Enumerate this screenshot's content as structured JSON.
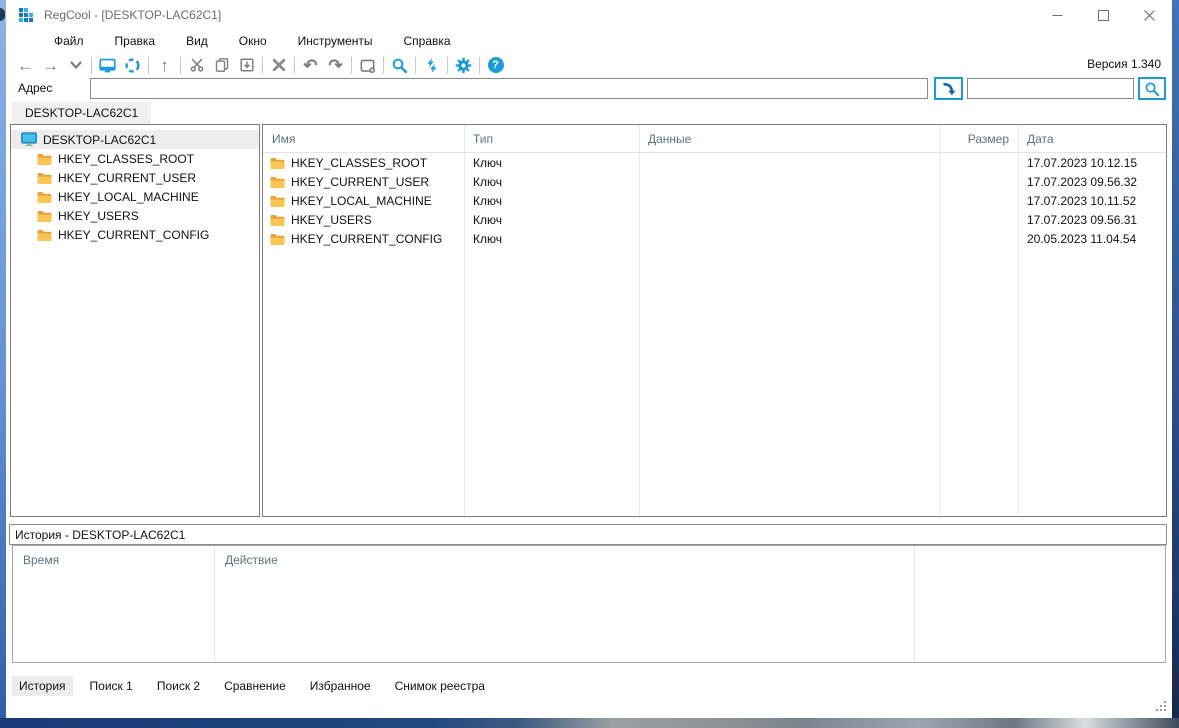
{
  "window": {
    "title": "RegCool - [DESKTOP-LAC62C1]",
    "version": "Версия 1.340"
  },
  "menu": [
    "Файл",
    "Правка",
    "Вид",
    "Окно",
    "Инструменты",
    "Справка"
  ],
  "toolbar": {
    "icons": [
      "back",
      "forward",
      "dropdown",
      "connect-computer",
      "refresh",
      "up",
      "cut",
      "copy",
      "import",
      "delete",
      "undo",
      "redo",
      "new-key",
      "search",
      "compare",
      "settings",
      "help"
    ],
    "glyphs": {
      "back": "←",
      "forward": "→",
      "up": "↑",
      "undo": "↶",
      "redo": "↷",
      "help": "?"
    }
  },
  "address": {
    "label": "Адрес",
    "value": "",
    "tab": "DESKTOP-LAC62C1"
  },
  "quick_search": {
    "value": ""
  },
  "tree": {
    "root": "DESKTOP-LAC62C1",
    "items": [
      "HKEY_CLASSES_ROOT",
      "HKEY_CURRENT_USER",
      "HKEY_LOCAL_MACHINE",
      "HKEY_USERS",
      "HKEY_CURRENT_CONFIG"
    ]
  },
  "list": {
    "columns": [
      "Имя",
      "Тип",
      "Данные",
      "Размер",
      "Дата"
    ],
    "rows": [
      {
        "name": "HKEY_CLASSES_ROOT",
        "type": "Ключ",
        "data": "",
        "size": "",
        "date": "17.07.2023 10.12.15"
      },
      {
        "name": "HKEY_CURRENT_USER",
        "type": "Ключ",
        "data": "",
        "size": "",
        "date": "17.07.2023 09.56.32"
      },
      {
        "name": "HKEY_LOCAL_MACHINE",
        "type": "Ключ",
        "data": "",
        "size": "",
        "date": "17.07.2023 10.11.52"
      },
      {
        "name": "HKEY_USERS",
        "type": "Ключ",
        "data": "",
        "size": "",
        "date": "17.07.2023 09.56.31"
      },
      {
        "name": "HKEY_CURRENT_CONFIG",
        "type": "Ключ",
        "data": "",
        "size": "",
        "date": "20.05.2023 11.04.54"
      }
    ]
  },
  "history": {
    "title": "История - DESKTOP-LAC62C1",
    "columns": [
      "Время",
      "Действие"
    ]
  },
  "bottom_tabs": [
    "История",
    "Поиск 1",
    "Поиск 2",
    "Сравнение",
    "Избранное",
    "Снимок реестра"
  ],
  "colors": {
    "accent": "#1b9cd8",
    "icon_gray": "#7d7d7d",
    "folder": "#f9c553",
    "header_text": "#5b7283",
    "selection": "#ededed"
  }
}
